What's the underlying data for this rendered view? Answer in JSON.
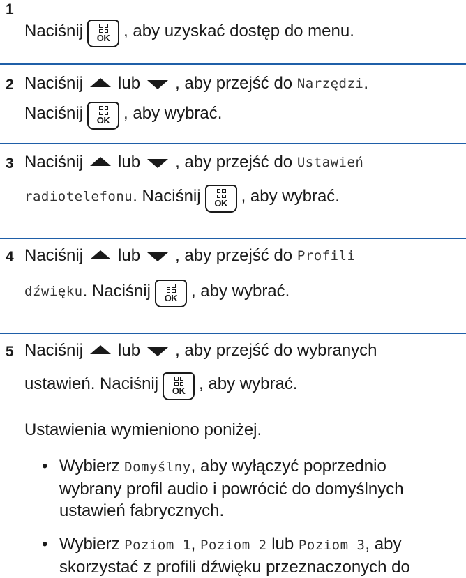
{
  "steps": [
    {
      "number": "1",
      "press": "Naciśnij",
      "text": ", aby uzyskać dostęp do menu."
    },
    {
      "number": "2",
      "press": "Naciśnij",
      "or": "lub",
      "goto": ", aby przejść do",
      "target": "Narzędzi",
      "target_end": ".",
      "press2": "Naciśnij",
      "select": ", aby wybrać."
    },
    {
      "number": "3",
      "press": "Naciśnij",
      "or": "lub",
      "goto": ", aby przejść do",
      "target_a": "Ustawień",
      "target_b": "radiotelefonu",
      "press2": ". Naciśnij",
      "select": ", aby wybrać."
    },
    {
      "number": "4",
      "press": "Naciśnij",
      "or": "lub",
      "goto": ", aby przejść do",
      "target_a": "Profili",
      "target_b": "dźwięku",
      "press2": ". Naciśnij",
      "select": ", aby wybrać."
    },
    {
      "number": "5",
      "press": "Naciśnij",
      "or": "lub",
      "goto": ", aby przejść do wybranych",
      "line2_a": "ustawień. Naciśnij",
      "select": ", aby wybrać.",
      "note": "Ustawienia wymieniono poniżej."
    }
  ],
  "bullets": [
    {
      "pre": "Wybierz",
      "code": "Domyślny",
      "post": ", aby wyłączyć poprzednio",
      "line2": "wybrany profil audio i powrócić do domyślnych",
      "line3": "ustawień fabrycznych."
    },
    {
      "pre": "Wybierz",
      "code1": "Poziom 1",
      "sep1": ",",
      "code2": "Poziom 2",
      "sep2": "lub",
      "code3": "Poziom 3",
      "post": ", aby",
      "line2": "skorzystać z profili dźwięku przeznaczonych do"
    }
  ],
  "key_label": "OK",
  "colors": {
    "separator": "#1f5fa8",
    "text": "#1a1a1a"
  }
}
